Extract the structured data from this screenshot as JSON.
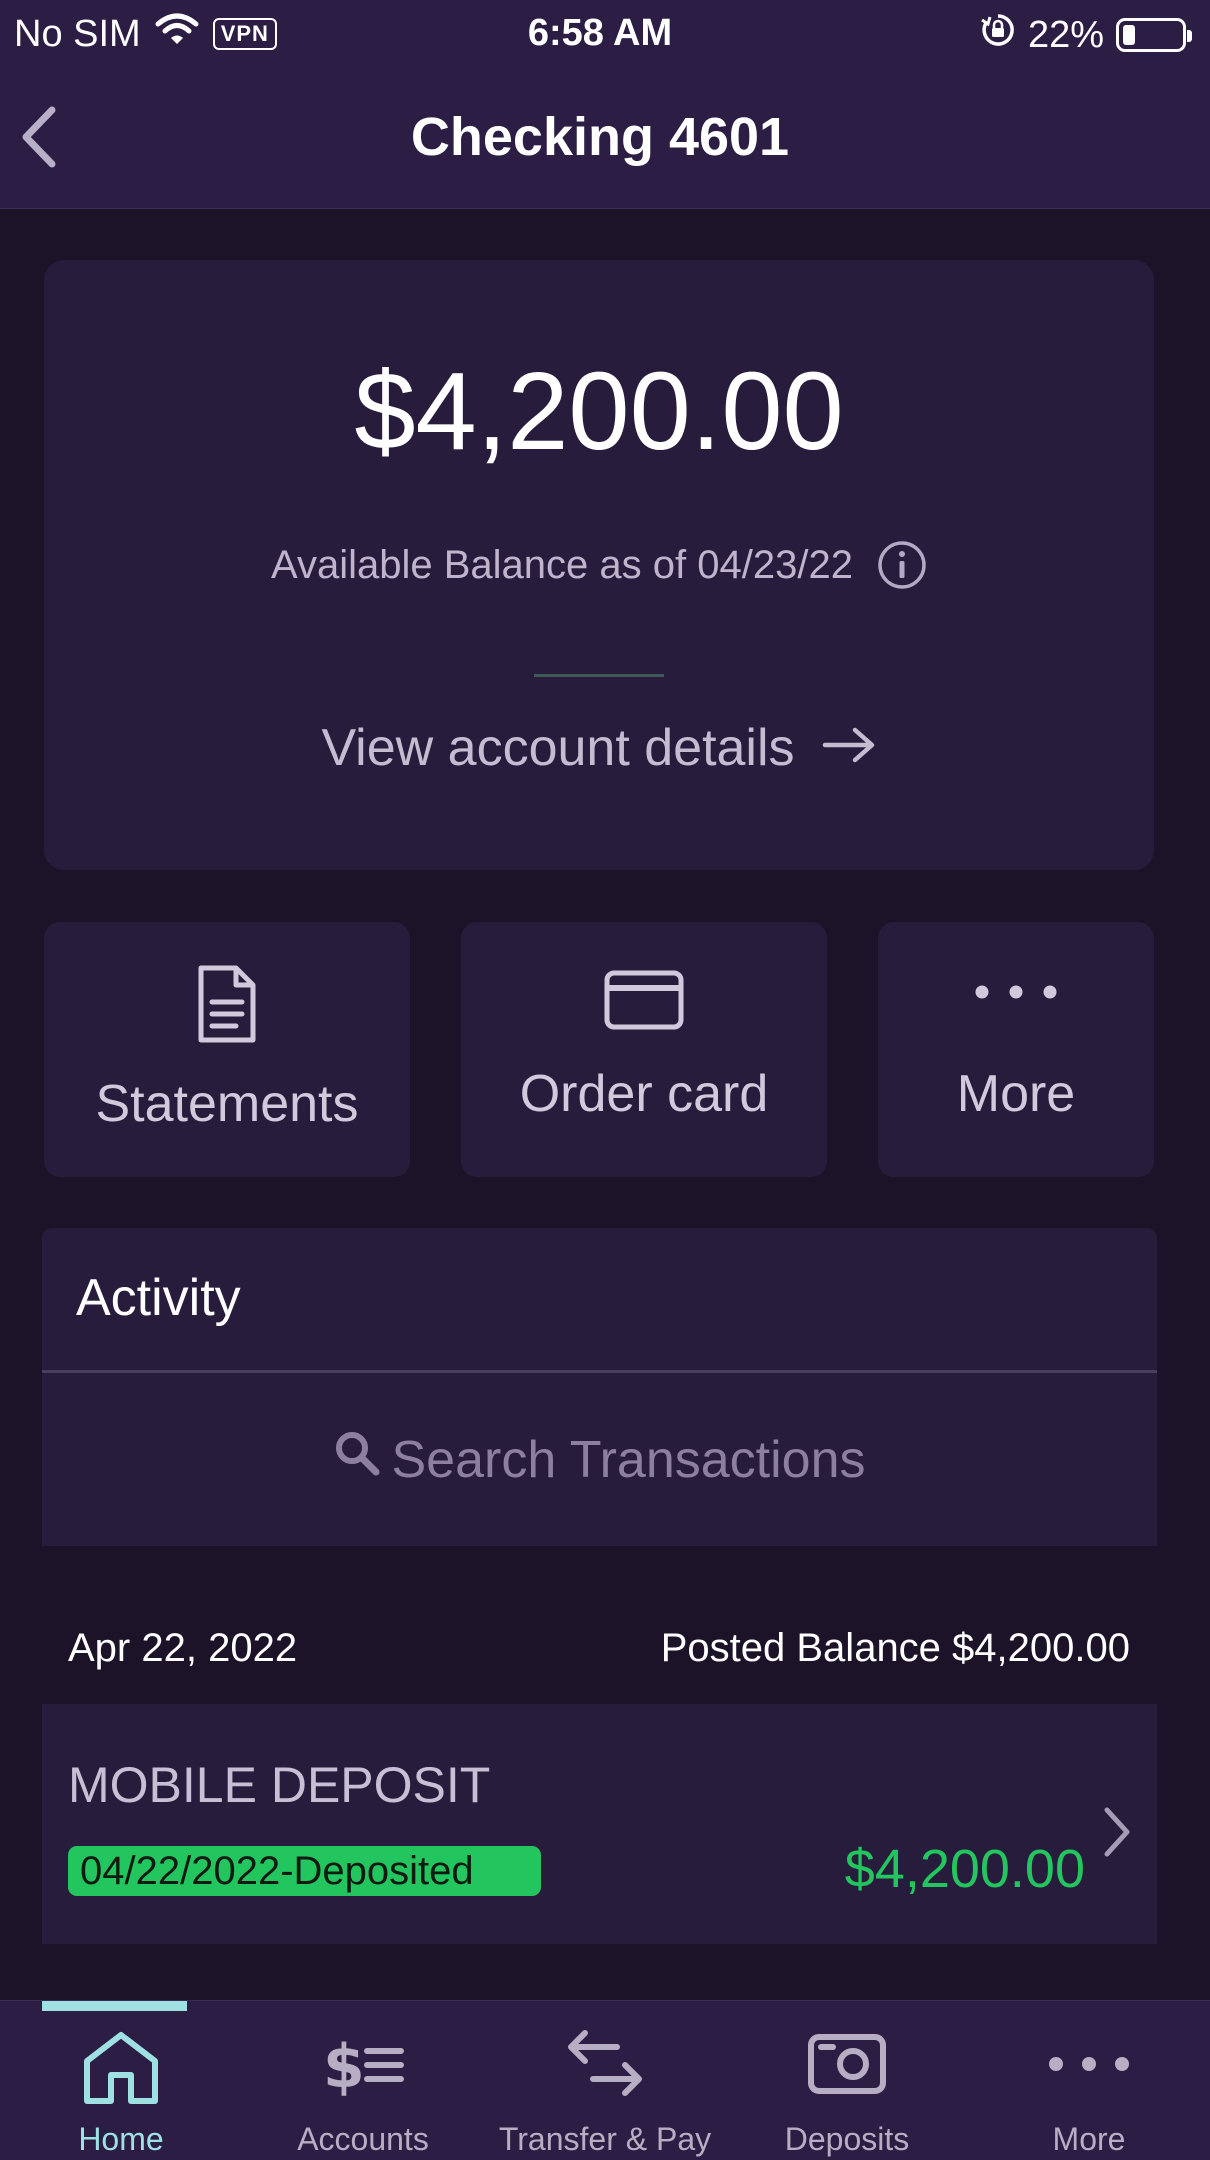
{
  "status_bar": {
    "carrier": "No SIM",
    "vpn": "VPN",
    "time": "6:58 AM",
    "battery_text": "22%",
    "battery_level": 0.22
  },
  "nav": {
    "title": "Checking 4601",
    "back_icon": "chevron-left-icon"
  },
  "balance": {
    "amount": "$4,200.00",
    "caption": "Available Balance as of 04/23/22",
    "view_details": "View account details"
  },
  "actions": {
    "statements": {
      "label": "Statements",
      "icon": "document-icon"
    },
    "order_card": {
      "label": "Order card",
      "icon": "credit-card-icon"
    },
    "more": {
      "label": "More",
      "icon": "ellipsis-icon"
    }
  },
  "activity": {
    "title": "Activity",
    "search_placeholder": "Search Transactions",
    "groups": [
      {
        "date": "Apr 22, 2022",
        "posted_balance": "Posted Balance $4,200.00",
        "transactions": [
          {
            "name": "MOBILE DEPOSIT",
            "status": "04/22/2022-Deposited",
            "amount": "$4,200.00"
          }
        ]
      }
    ]
  },
  "tab_bar": {
    "tabs": [
      {
        "label": "Home",
        "icon": "home-icon",
        "active": true
      },
      {
        "label": "Accounts",
        "icon": "accounts-icon",
        "active": false
      },
      {
        "label": "Transfer & Pay",
        "icon": "transfer-icon",
        "active": false
      },
      {
        "label": "Deposits",
        "icon": "deposits-icon",
        "active": false
      },
      {
        "label": "More",
        "icon": "more-icon",
        "active": false
      }
    ]
  },
  "colors": {
    "background": "#1c1328",
    "header": "#2c1d45",
    "card": "#281c3d",
    "accent": "#9fe0e2",
    "positive": "#22c55e"
  }
}
